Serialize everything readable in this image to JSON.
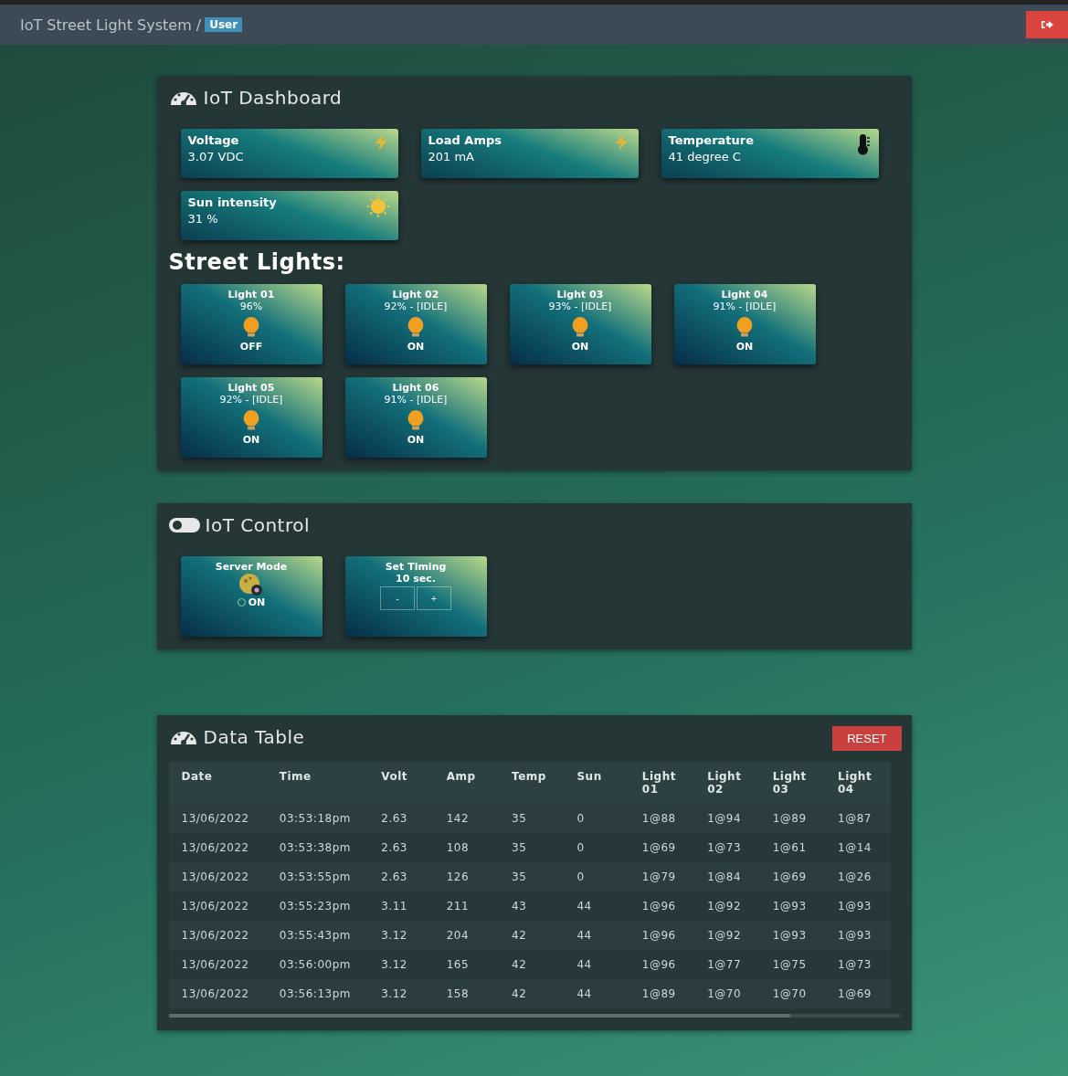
{
  "navbar": {
    "title": "IoT Street Light System /",
    "badge": "User"
  },
  "dashboard": {
    "title": "IoT Dashboard",
    "stats": [
      {
        "label": "Voltage",
        "value": "3.07 VDC",
        "kind": "bolt"
      },
      {
        "label": "Load Amps",
        "value": "201 mA",
        "kind": "bolt"
      },
      {
        "label": "Temperature",
        "value": "41 degree C",
        "kind": "thermometer"
      },
      {
        "label": "Sun intensity",
        "value": "31 %",
        "kind": "sun"
      }
    ],
    "lights_heading": "Street Lights:",
    "lights": [
      {
        "name": "Light 01",
        "reading": "96%",
        "status": "OFF"
      },
      {
        "name": "Light 02",
        "reading": "92% - [IDLE]",
        "status": "ON"
      },
      {
        "name": "Light 03",
        "reading": "93% - [IDLE]",
        "status": "ON"
      },
      {
        "name": "Light 04",
        "reading": "91% - [IDLE]",
        "status": "ON"
      },
      {
        "name": "Light 05",
        "reading": "92% - [IDLE]",
        "status": "ON"
      },
      {
        "name": "Light 06",
        "reading": "91% - [IDLE]",
        "status": "ON"
      }
    ]
  },
  "control": {
    "title": "IoT Control",
    "server_mode": {
      "label": "Server Mode",
      "option": "ON",
      "checked": false
    },
    "timing": {
      "label": "Set Timing",
      "value": "10 sec.",
      "buttons": [
        "-",
        "+"
      ]
    }
  },
  "data_table": {
    "title": "Data Table",
    "reset": "RESET",
    "columns": [
      "Date",
      "Time",
      "Volt",
      "Amp",
      "Temp",
      "Sun",
      "Light 01",
      "Light 02",
      "Light 03",
      "Light 04"
    ],
    "rows": [
      [
        "13/06/2022",
        "03:53:18pm",
        "2.63",
        "142",
        "35",
        "0",
        "1@88",
        "1@94",
        "1@89",
        "1@87"
      ],
      [
        "13/06/2022",
        "03:53:38pm",
        "2.63",
        "108",
        "35",
        "0",
        "1@69",
        "1@73",
        "1@61",
        "1@14"
      ],
      [
        "13/06/2022",
        "03:53:55pm",
        "2.63",
        "126",
        "35",
        "0",
        "1@79",
        "1@84",
        "1@69",
        "1@26"
      ],
      [
        "13/06/2022",
        "03:55:23pm",
        "3.11",
        "211",
        "43",
        "44",
        "1@96",
        "1@92",
        "1@93",
        "1@93"
      ],
      [
        "13/06/2022",
        "03:55:43pm",
        "3.12",
        "204",
        "42",
        "44",
        "1@96",
        "1@92",
        "1@93",
        "1@93"
      ],
      [
        "13/06/2022",
        "03:56:00pm",
        "3.12",
        "165",
        "42",
        "44",
        "1@96",
        "1@77",
        "1@75",
        "1@73"
      ],
      [
        "13/06/2022",
        "03:56:13pm",
        "3.12",
        "158",
        "42",
        "44",
        "1@89",
        "1@70",
        "1@70",
        "1@69"
      ]
    ]
  }
}
